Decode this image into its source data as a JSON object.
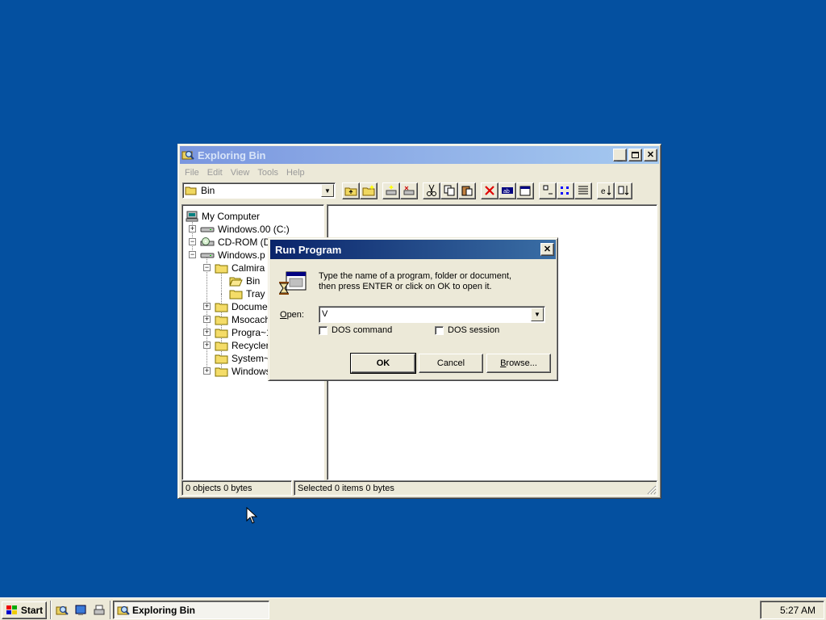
{
  "explorer": {
    "title": "Exploring Bin",
    "menus": [
      "File",
      "Edit",
      "View",
      "Tools",
      "Help"
    ],
    "address": "Bin",
    "tree": [
      {
        "label": "My Computer",
        "icon": "computer-icon"
      },
      {
        "label": "Windows.00 (C:)",
        "icon": "drive-icon"
      },
      {
        "label": "CD-ROM (D:)",
        "icon": "cdrom-icon"
      },
      {
        "label": "Windows.p (E",
        "icon": "drive-icon"
      },
      {
        "label": "Calmira",
        "icon": "folder-icon"
      },
      {
        "label": "Bin",
        "icon": "folder-open-icon"
      },
      {
        "label": "Tray",
        "icon": "folder-icon"
      },
      {
        "label": "Docume~",
        "icon": "folder-icon"
      },
      {
        "label": "Msocache",
        "icon": "folder-icon"
      },
      {
        "label": "Progra~1",
        "icon": "folder-icon"
      },
      {
        "label": "Recycler",
        "icon": "folder-icon"
      },
      {
        "label": "System~1",
        "icon": "folder-icon"
      },
      {
        "label": "Windows",
        "icon": "folder-icon"
      }
    ],
    "status": {
      "left": "0 objects   0 bytes",
      "right": "Selected 0 items   0 bytes"
    }
  },
  "run_dialog": {
    "title": "Run Program",
    "line1": "Type the name of a program, folder or document,",
    "line2": "then press ENTER or click on OK to open it.",
    "open_label": "Open:",
    "open_value": "V",
    "dos_command": "DOS command",
    "dos_session": "DOS session",
    "ok": "OK",
    "cancel": "Cancel",
    "browse": "Browse..."
  },
  "taskbar": {
    "start": "Start",
    "task": "Exploring Bin",
    "clock": "5:27 AM"
  },
  "colors": {
    "desktop": "#0450a0",
    "title_active": "#0a246a",
    "title_inactive": "#7a96df",
    "face": "#ece9d8"
  }
}
